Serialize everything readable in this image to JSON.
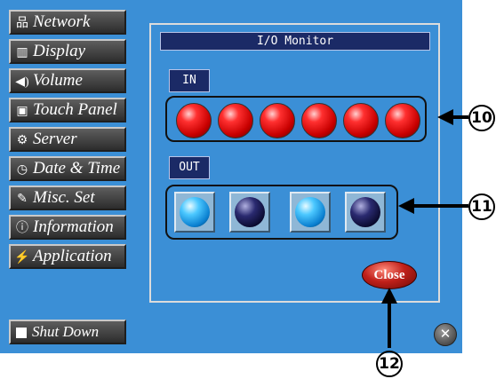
{
  "sidebar": {
    "items": [
      {
        "label": "Network",
        "icon": "network-icon"
      },
      {
        "label": "Display",
        "icon": "display-icon"
      },
      {
        "label": "Volume",
        "icon": "volume-icon"
      },
      {
        "label": "Touch Panel",
        "icon": "touch-panel-icon"
      },
      {
        "label": "Server",
        "icon": "server-icon"
      },
      {
        "label": "Date & Time",
        "icon": "clock-icon"
      },
      {
        "label": "Misc. Set",
        "icon": "edit-icon"
      },
      {
        "label": "Information",
        "icon": "info-icon"
      },
      {
        "label": "Application",
        "icon": "lightning-icon"
      }
    ],
    "shutdown_label": "Shut Down"
  },
  "panel": {
    "title": "I/O Monitor",
    "in_label": "IN",
    "out_label": "OUT",
    "in_leds": [
      "on",
      "on",
      "on",
      "on",
      "on",
      "on"
    ],
    "out_leds": [
      "on",
      "off",
      "on",
      "off"
    ],
    "close_label": "Close"
  },
  "callouts": {
    "c10": "10",
    "c11": "11",
    "c12": "12"
  },
  "colors": {
    "screen_bg": "#3b8fd6",
    "title_bg": "#1b2a66",
    "led_in": "#ff0000",
    "led_out_on": "#2ab0f0",
    "led_out_off": "#14143c"
  }
}
